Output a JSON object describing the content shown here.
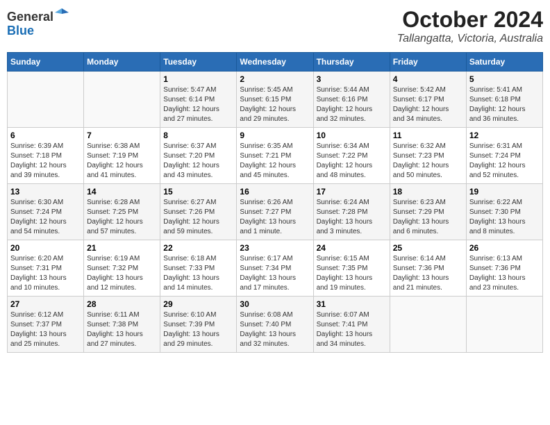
{
  "logo": {
    "general": "General",
    "blue": "Blue"
  },
  "title": "October 2024",
  "subtitle": "Tallangatta, Victoria, Australia",
  "days_header": [
    "Sunday",
    "Monday",
    "Tuesday",
    "Wednesday",
    "Thursday",
    "Friday",
    "Saturday"
  ],
  "weeks": [
    [
      {
        "day": "",
        "info": ""
      },
      {
        "day": "",
        "info": ""
      },
      {
        "day": "1",
        "info": "Sunrise: 5:47 AM\nSunset: 6:14 PM\nDaylight: 12 hours\nand 27 minutes."
      },
      {
        "day": "2",
        "info": "Sunrise: 5:45 AM\nSunset: 6:15 PM\nDaylight: 12 hours\nand 29 minutes."
      },
      {
        "day": "3",
        "info": "Sunrise: 5:44 AM\nSunset: 6:16 PM\nDaylight: 12 hours\nand 32 minutes."
      },
      {
        "day": "4",
        "info": "Sunrise: 5:42 AM\nSunset: 6:17 PM\nDaylight: 12 hours\nand 34 minutes."
      },
      {
        "day": "5",
        "info": "Sunrise: 5:41 AM\nSunset: 6:18 PM\nDaylight: 12 hours\nand 36 minutes."
      }
    ],
    [
      {
        "day": "6",
        "info": "Sunrise: 6:39 AM\nSunset: 7:18 PM\nDaylight: 12 hours\nand 39 minutes."
      },
      {
        "day": "7",
        "info": "Sunrise: 6:38 AM\nSunset: 7:19 PM\nDaylight: 12 hours\nand 41 minutes."
      },
      {
        "day": "8",
        "info": "Sunrise: 6:37 AM\nSunset: 7:20 PM\nDaylight: 12 hours\nand 43 minutes."
      },
      {
        "day": "9",
        "info": "Sunrise: 6:35 AM\nSunset: 7:21 PM\nDaylight: 12 hours\nand 45 minutes."
      },
      {
        "day": "10",
        "info": "Sunrise: 6:34 AM\nSunset: 7:22 PM\nDaylight: 12 hours\nand 48 minutes."
      },
      {
        "day": "11",
        "info": "Sunrise: 6:32 AM\nSunset: 7:23 PM\nDaylight: 12 hours\nand 50 minutes."
      },
      {
        "day": "12",
        "info": "Sunrise: 6:31 AM\nSunset: 7:24 PM\nDaylight: 12 hours\nand 52 minutes."
      }
    ],
    [
      {
        "day": "13",
        "info": "Sunrise: 6:30 AM\nSunset: 7:24 PM\nDaylight: 12 hours\nand 54 minutes."
      },
      {
        "day": "14",
        "info": "Sunrise: 6:28 AM\nSunset: 7:25 PM\nDaylight: 12 hours\nand 57 minutes."
      },
      {
        "day": "15",
        "info": "Sunrise: 6:27 AM\nSunset: 7:26 PM\nDaylight: 12 hours\nand 59 minutes."
      },
      {
        "day": "16",
        "info": "Sunrise: 6:26 AM\nSunset: 7:27 PM\nDaylight: 13 hours\nand 1 minute."
      },
      {
        "day": "17",
        "info": "Sunrise: 6:24 AM\nSunset: 7:28 PM\nDaylight: 13 hours\nand 3 minutes."
      },
      {
        "day": "18",
        "info": "Sunrise: 6:23 AM\nSunset: 7:29 PM\nDaylight: 13 hours\nand 6 minutes."
      },
      {
        "day": "19",
        "info": "Sunrise: 6:22 AM\nSunset: 7:30 PM\nDaylight: 13 hours\nand 8 minutes."
      }
    ],
    [
      {
        "day": "20",
        "info": "Sunrise: 6:20 AM\nSunset: 7:31 PM\nDaylight: 13 hours\nand 10 minutes."
      },
      {
        "day": "21",
        "info": "Sunrise: 6:19 AM\nSunset: 7:32 PM\nDaylight: 13 hours\nand 12 minutes."
      },
      {
        "day": "22",
        "info": "Sunrise: 6:18 AM\nSunset: 7:33 PM\nDaylight: 13 hours\nand 14 minutes."
      },
      {
        "day": "23",
        "info": "Sunrise: 6:17 AM\nSunset: 7:34 PM\nDaylight: 13 hours\nand 17 minutes."
      },
      {
        "day": "24",
        "info": "Sunrise: 6:15 AM\nSunset: 7:35 PM\nDaylight: 13 hours\nand 19 minutes."
      },
      {
        "day": "25",
        "info": "Sunrise: 6:14 AM\nSunset: 7:36 PM\nDaylight: 13 hours\nand 21 minutes."
      },
      {
        "day": "26",
        "info": "Sunrise: 6:13 AM\nSunset: 7:36 PM\nDaylight: 13 hours\nand 23 minutes."
      }
    ],
    [
      {
        "day": "27",
        "info": "Sunrise: 6:12 AM\nSunset: 7:37 PM\nDaylight: 13 hours\nand 25 minutes."
      },
      {
        "day": "28",
        "info": "Sunrise: 6:11 AM\nSunset: 7:38 PM\nDaylight: 13 hours\nand 27 minutes."
      },
      {
        "day": "29",
        "info": "Sunrise: 6:10 AM\nSunset: 7:39 PM\nDaylight: 13 hours\nand 29 minutes."
      },
      {
        "day": "30",
        "info": "Sunrise: 6:08 AM\nSunset: 7:40 PM\nDaylight: 13 hours\nand 32 minutes."
      },
      {
        "day": "31",
        "info": "Sunrise: 6:07 AM\nSunset: 7:41 PM\nDaylight: 13 hours\nand 34 minutes."
      },
      {
        "day": "",
        "info": ""
      },
      {
        "day": "",
        "info": ""
      }
    ]
  ]
}
